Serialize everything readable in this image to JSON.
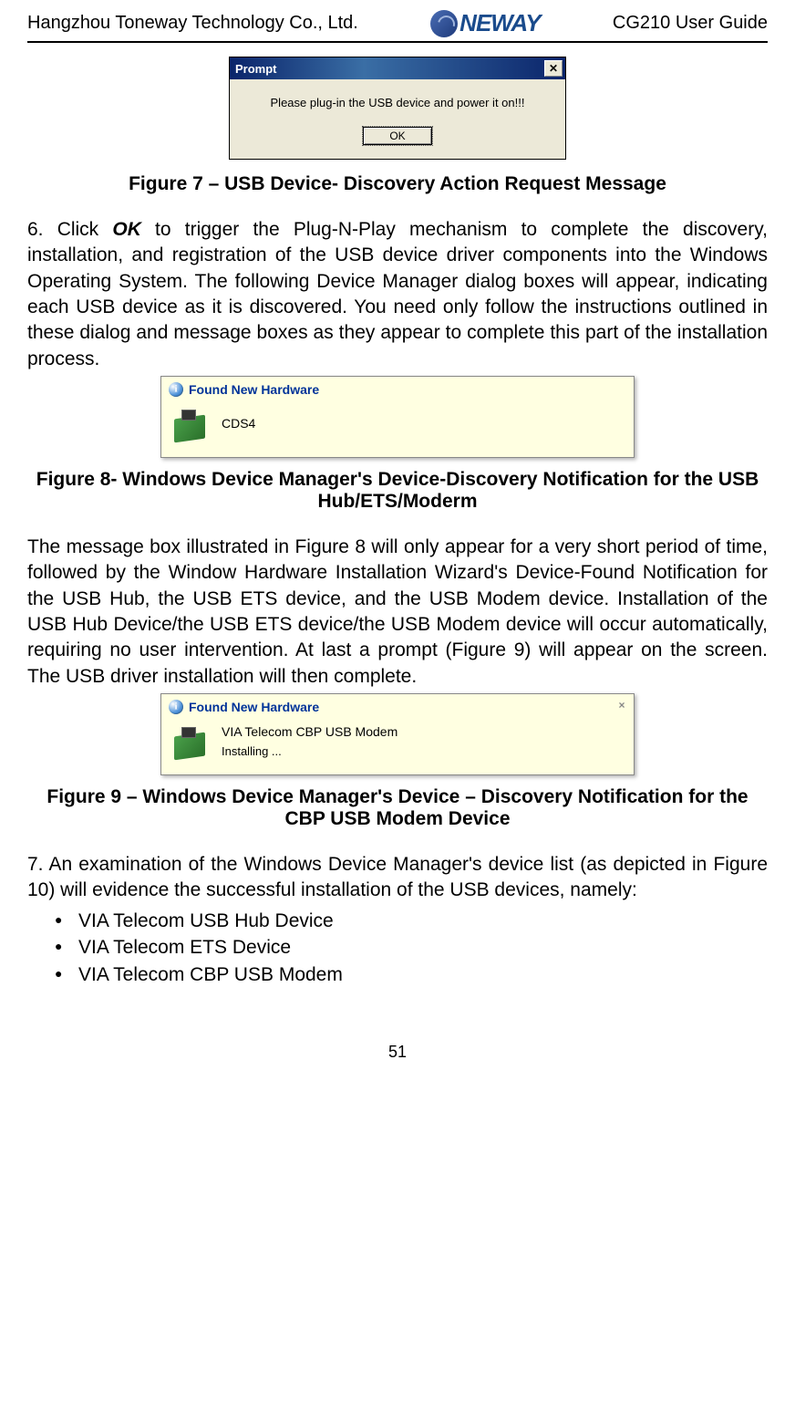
{
  "header": {
    "company": "Hangzhou Toneway Technology Co., Ltd.",
    "logo_text": "NEWAY",
    "doc_title": "CG210 User Guide"
  },
  "prompt_dialog": {
    "title": "Prompt",
    "message": "Please plug-in the USB device and power it on!!!",
    "ok_label": "OK"
  },
  "figure7_caption": "Figure 7 – USB Device- Discovery Action Request Message",
  "para6_prefix": "6. Click ",
  "para6_ok": "OK",
  "para6_rest": " to trigger the Plug-N-Play mechanism to complete the discovery, installation, and registration of the USB device driver components into the Windows Operating System. The following Device Manager dialog boxes will appear, indicating each USB device as it is discovered. You need only follow the instructions outlined in these dialog and message boxes as they appear to complete this part of the installation process.",
  "found_hw1": {
    "title": "Found New Hardware",
    "device": "CDS4"
  },
  "figure8_caption": "Figure 8- Windows Device Manager's Device-Discovery Notification for the USB Hub/ETS/Moderm",
  "para_fig8": "The message box illustrated in Figure 8 will only appear for a very short period of time, followed by the Window Hardware Installation Wizard's Device-Found Notification for the USB Hub, the USB ETS device, and the USB Modem device. Installation of the USB Hub Device/the USB ETS device/the USB Modem device will occur automatically, requiring no user intervention. At last a prompt (Figure 9) will appear on the screen. The USB driver installation will then complete.",
  "found_hw2": {
    "title": "Found New Hardware",
    "device": "VIA Telecom CBP USB Modem",
    "status": "Installing ..."
  },
  "figure9_caption": "Figure 9 – Windows Device Manager's Device – Discovery Notification for the CBP USB Modem Device",
  "para7": "7. An examination of the Windows Device Manager's device list (as depicted in Figure 10) will evidence the successful installation of the USB devices, namely:",
  "devices": {
    "d1": "VIA Telecom USB Hub Device",
    "d2": "VIA Telecom ETS Device",
    "d3": "VIA Telecom CBP USB Modem"
  },
  "page_number": "51"
}
